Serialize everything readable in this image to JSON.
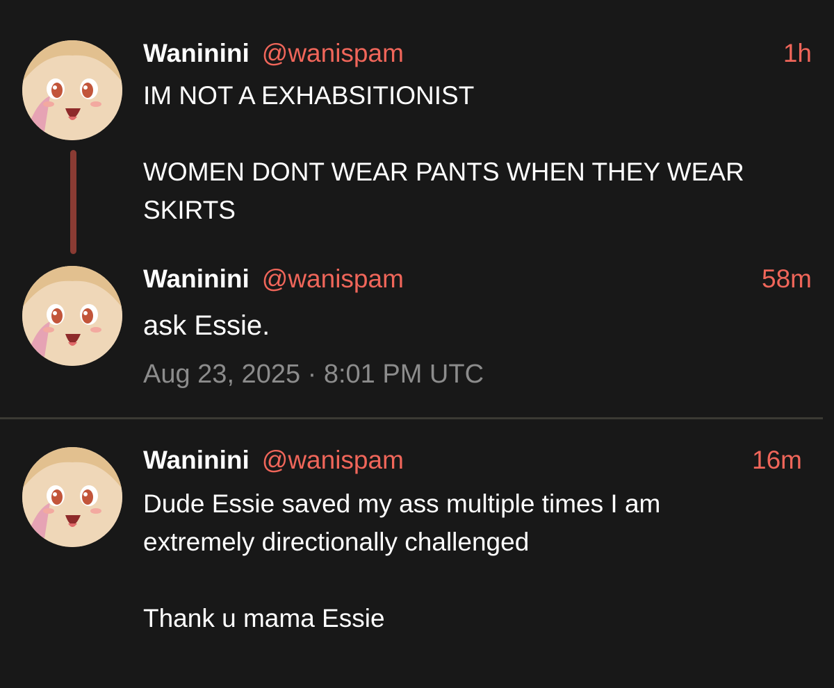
{
  "colors": {
    "background": "#181818",
    "accent": "#f0665a",
    "thread_line": "#8a3b33",
    "date_text": "#8c8c8c",
    "divider": "#3b3a34"
  },
  "posts": [
    {
      "author_name": "Waninini",
      "author_handle": "@wanispam",
      "time": "1h",
      "content": "IM NOT A EXHABSITIONIST\n\nWOMEN DONT WEAR PANTS WHEN THEY WEAR SKIRTS",
      "avatar_icon": "anime-girl-avatar"
    },
    {
      "author_name": "Waninini",
      "author_handle": "@wanispam",
      "time": "58m",
      "content": "ask Essie.",
      "date": "Aug 23, 2025 · 8:01 PM UTC",
      "avatar_icon": "anime-girl-avatar"
    },
    {
      "author_name": "Waninini",
      "author_handle": "@wanispam",
      "time": "16m",
      "content": "Dude Essie saved my ass multiple times I am extremely directionally challenged\n\nThank u mama Essie",
      "avatar_icon": "anime-girl-avatar"
    }
  ]
}
